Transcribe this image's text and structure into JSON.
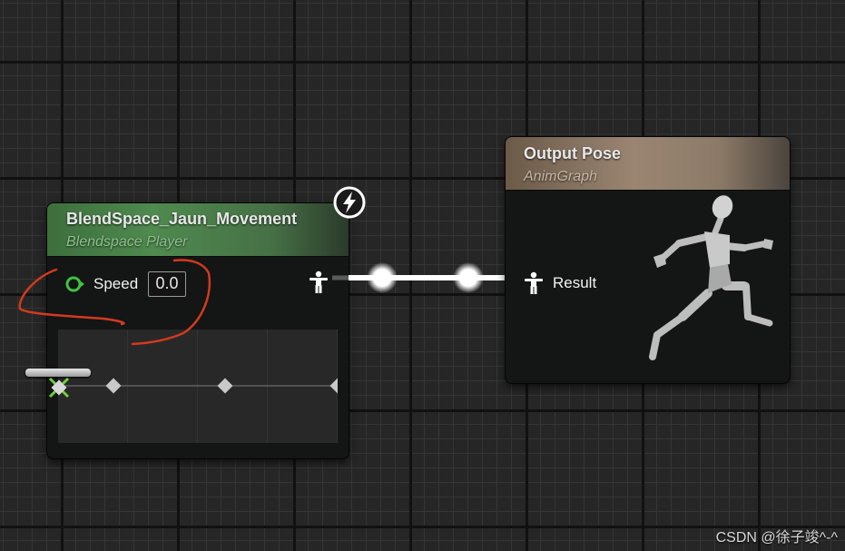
{
  "blendspace_node": {
    "title": "BlendSpace_Jaun_Movement",
    "subtitle": "Blendspace Player",
    "speed_pin": {
      "label": "Speed",
      "value": "0.0"
    }
  },
  "output_node": {
    "title": "Output Pose",
    "subtitle": "AnimGraph",
    "result_pin": {
      "label": "Result"
    }
  },
  "icons": {
    "pose_pin": "pose-figure-icon",
    "fast_path": "lightning-icon",
    "speed_pin": "float-pin-icon",
    "preview": "running-mannequin-icon"
  },
  "colors": {
    "blendspace_header": "#4f8a4f",
    "output_header": "#9a8572",
    "float_pin": "#3fc43f",
    "annotation": "#d23a1e",
    "wire": "#ffffff"
  },
  "blend_preview": {
    "sample_count": 4,
    "current_position": 0
  },
  "watermark": "CSDN @徐子竣^-^"
}
